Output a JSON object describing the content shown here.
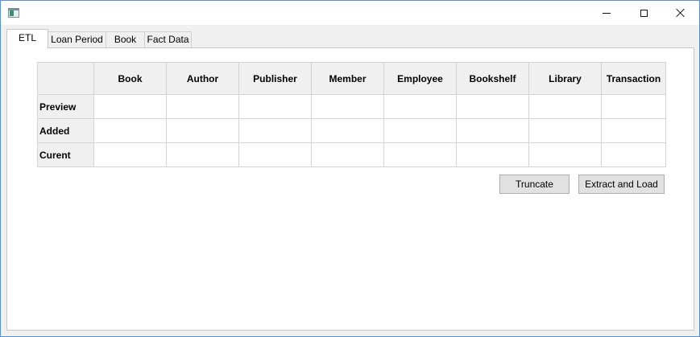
{
  "window": {
    "icon": "app-window-icon",
    "controls": {
      "minimize_icon": "minimize-icon",
      "maximize_icon": "maximize-icon",
      "close_icon": "close-icon"
    }
  },
  "tabs": [
    {
      "label": "ETL",
      "active": true
    },
    {
      "label": "Loan Period",
      "active": false
    },
    {
      "label": "Book",
      "active": false
    },
    {
      "label": "Fact Data",
      "active": false
    }
  ],
  "grid": {
    "columns": [
      "Book",
      "Author",
      "Publisher",
      "Member",
      "Employee",
      "Bookshelf",
      "Library",
      "Transaction"
    ],
    "rows": [
      {
        "label": "Preview",
        "cells": [
          "",
          "",
          "",
          "",
          "",
          "",
          "",
          ""
        ]
      },
      {
        "label": "Added",
        "cells": [
          "",
          "",
          "",
          "",
          "",
          "",
          "",
          ""
        ]
      },
      {
        "label": "Curent",
        "cells": [
          "",
          "",
          "",
          "",
          "",
          "",
          "",
          ""
        ]
      }
    ]
  },
  "actions": {
    "truncate_label": "Truncate",
    "extract_load_label": "Extract and Load"
  },
  "colors": {
    "window_border": "#5a8fd6",
    "client_background": "#f0f0f0",
    "button_face": "#e1e1e1",
    "header_background": "#f0f0f0"
  }
}
